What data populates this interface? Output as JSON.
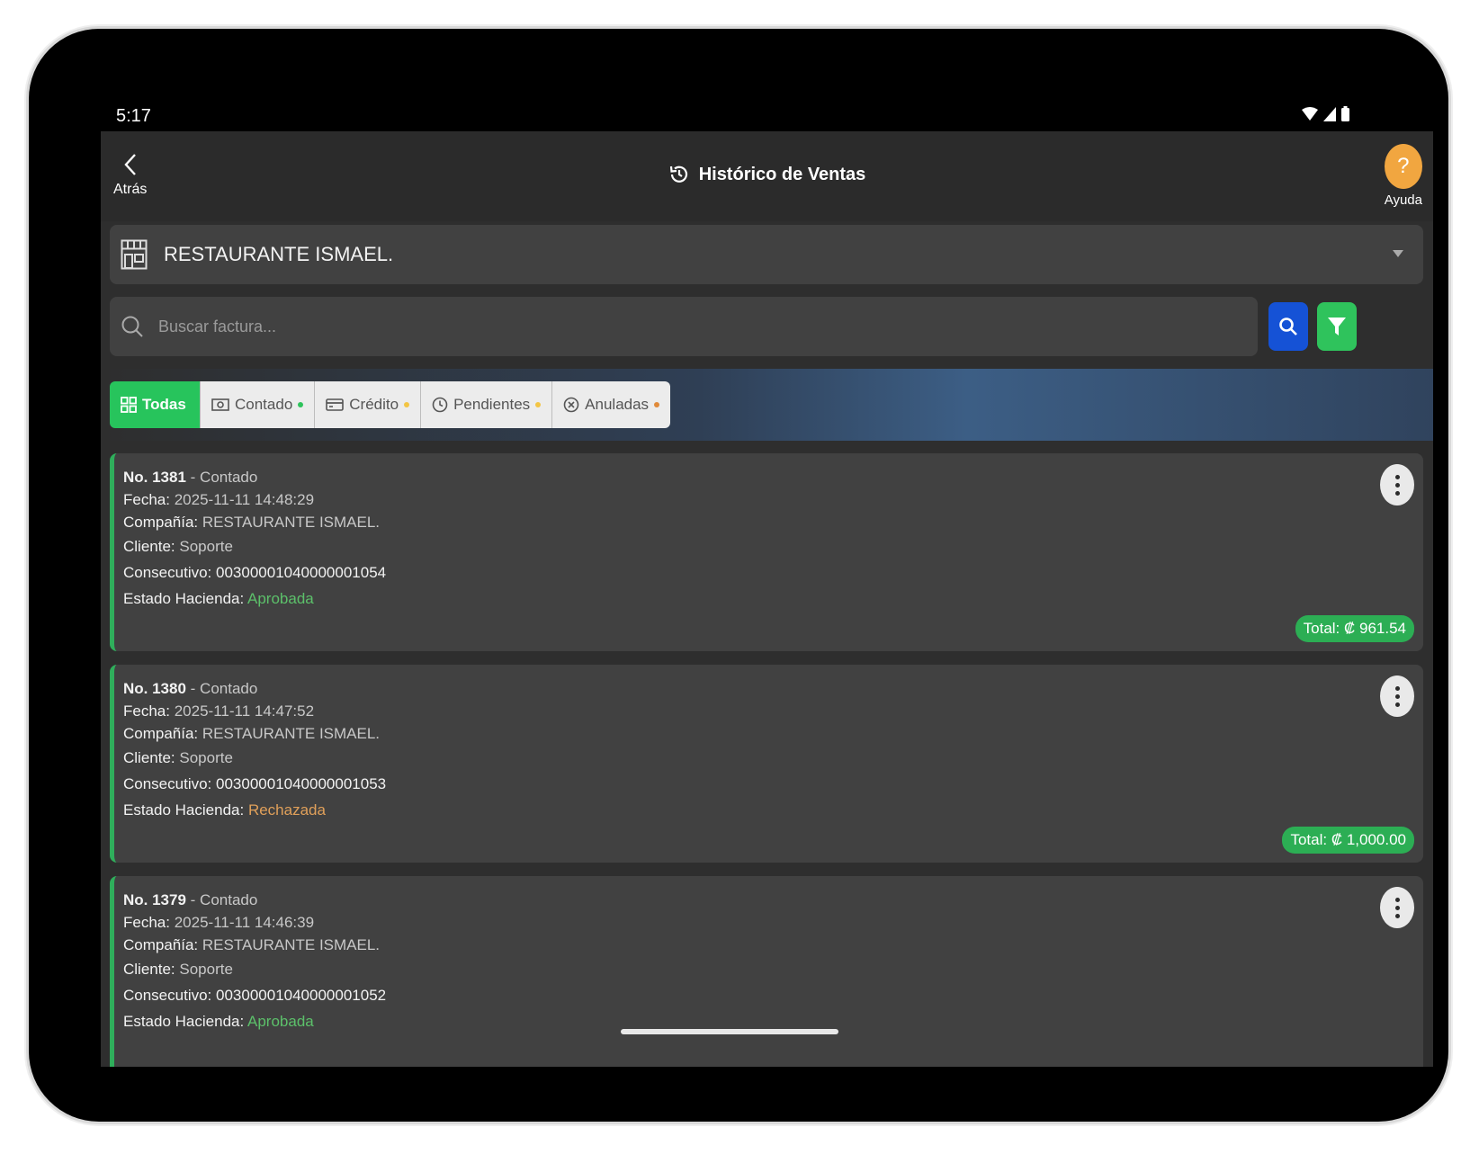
{
  "status_bar": {
    "time": "5:17"
  },
  "app_bar": {
    "back_label": "Atrás",
    "title": "Histórico de Ventas",
    "help_label": "Ayuda",
    "help_glyph": "?"
  },
  "company_selector": {
    "value": "RESTAURANTE ISMAEL."
  },
  "search": {
    "placeholder": "Buscar factura..."
  },
  "colors": {
    "accent_green": "#27c45c",
    "search_blue": "#1552d6",
    "help_orange": "#f1a640",
    "status_approved": "#5cc06a",
    "status_rejected": "#e0a05a"
  },
  "tabs": [
    {
      "label": "Todas",
      "icon": "grid-icon",
      "active": true,
      "dot": ""
    },
    {
      "label": "Contado",
      "icon": "cash-icon",
      "active": false,
      "dot": "#2fc35c"
    },
    {
      "label": "Crédito",
      "icon": "card-icon",
      "active": false,
      "dot": "#f3c544"
    },
    {
      "label": "Pendientes",
      "icon": "clock-icon",
      "active": false,
      "dot": "#f3c544"
    },
    {
      "label": "Anuladas",
      "icon": "cancel-icon",
      "active": false,
      "dot": "#e08a3a"
    }
  ],
  "field_labels": {
    "fecha": "Fecha:",
    "compania": "Compañía:",
    "cliente": "Cliente:",
    "consecutivo": "Consecutivo:",
    "estado": "Estado Hacienda:"
  },
  "invoices": [
    {
      "number": "No. 1381",
      "type": "- Contado",
      "fecha": "2025-11-11 14:48:29",
      "compania": "RESTAURANTE ISMAEL.",
      "cliente": "Soporte",
      "consecutivo": "00300001040000001054",
      "estado": "Aprobada",
      "total": "Total: ₡ 961.54"
    },
    {
      "number": "No. 1380",
      "type": "- Contado",
      "fecha": "2025-11-11 14:47:52",
      "compania": "RESTAURANTE ISMAEL.",
      "cliente": "Soporte",
      "consecutivo": "00300001040000001053",
      "estado": "Rechazada",
      "total": "Total: ₡ 1,000.00"
    },
    {
      "number": "No. 1379",
      "type": "- Contado",
      "fecha": "2025-11-11 14:46:39",
      "compania": "RESTAURANTE ISMAEL.",
      "cliente": "Soporte",
      "consecutivo": "00300001040000001052",
      "estado": "Aprobada",
      "total": ""
    }
  ]
}
